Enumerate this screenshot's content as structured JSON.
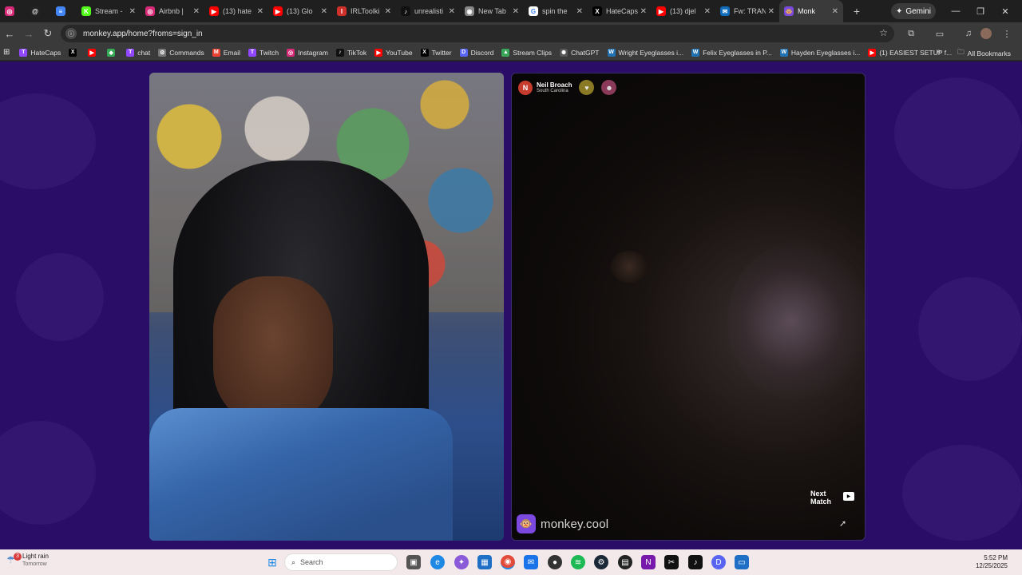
{
  "tabs": [
    {
      "label": "",
      "icon": "instagram-icon",
      "color": "#d62976",
      "glyph": "◎"
    },
    {
      "label": "",
      "icon": "threads-icon",
      "color": "#222222",
      "glyph": "@"
    },
    {
      "label": "",
      "icon": "docs-icon",
      "color": "#4285f4",
      "glyph": "≡"
    },
    {
      "label": "Stream -",
      "icon": "kick-icon",
      "color": "#53fc18",
      "glyph": "K"
    },
    {
      "label": "Airbnb |",
      "icon": "instagram-icon",
      "color": "#d62976",
      "glyph": "◎"
    },
    {
      "label": "(13) hate",
      "icon": "youtube-icon",
      "color": "#ff0000",
      "glyph": "▶"
    },
    {
      "label": "(13) Glo",
      "icon": "youtube-icon",
      "color": "#ff0000",
      "glyph": "▶"
    },
    {
      "label": "IRLToolki",
      "icon": "irltoolkit-icon",
      "color": "#d0302a",
      "glyph": "I"
    },
    {
      "label": "unrealisti",
      "icon": "tiktok-icon",
      "color": "#111111",
      "glyph": "♪"
    },
    {
      "label": "New Tab",
      "icon": "chrome-icon",
      "color": "#888888",
      "glyph": "◉"
    },
    {
      "label": "spin the",
      "icon": "google-icon",
      "color": "#ffffff",
      "glyph": "G"
    },
    {
      "label": "HateCaps",
      "icon": "x-icon",
      "color": "#000000",
      "glyph": "X"
    },
    {
      "label": "(13) djel",
      "icon": "youtube-icon",
      "color": "#ff0000",
      "glyph": "▶"
    },
    {
      "label": "Fw: TRAN",
      "icon": "outlook-icon",
      "color": "#0f6cbd",
      "glyph": "✉"
    },
    {
      "label": "Monk",
      "icon": "monkey-icon",
      "color": "#7b48e0",
      "glyph": "🐵",
      "active": true
    }
  ],
  "gemini_label": "Gemini",
  "address": "monkey.app/home?froms=sign_in",
  "bookmarks": [
    {
      "label": "HateCaps",
      "icon": "twitch-icon",
      "color": "#9146ff",
      "glyph": "T"
    },
    {
      "label": "",
      "icon": "x-icon",
      "color": "#000000",
      "glyph": "X"
    },
    {
      "label": "",
      "icon": "youtube-icon",
      "color": "#ff0000",
      "glyph": "▶"
    },
    {
      "label": "",
      "icon": "maps-icon",
      "color": "#34a853",
      "glyph": "◆"
    },
    {
      "label": "chat",
      "icon": "twitch-icon",
      "color": "#9146ff",
      "glyph": "T"
    },
    {
      "label": "Commands",
      "icon": "settings-icon",
      "color": "#777777",
      "glyph": "⚙"
    },
    {
      "label": "Email",
      "icon": "gmail-icon",
      "color": "#ea4335",
      "glyph": "M"
    },
    {
      "label": "Twitch",
      "icon": "twitch-icon",
      "color": "#9146ff",
      "glyph": "T"
    },
    {
      "label": "Instagram",
      "icon": "instagram-icon",
      "color": "#d62976",
      "glyph": "◎"
    },
    {
      "label": "TikTok",
      "icon": "tiktok-icon",
      "color": "#111111",
      "glyph": "♪"
    },
    {
      "label": "YouTube",
      "icon": "youtube-icon",
      "color": "#ff0000",
      "glyph": "▶"
    },
    {
      "label": "Twitter",
      "icon": "x-icon",
      "color": "#000000",
      "glyph": "X"
    },
    {
      "label": "Discord",
      "icon": "discord-icon",
      "color": "#5865f2",
      "glyph": "D"
    },
    {
      "label": "Stream Clips",
      "icon": "streamclips-icon",
      "color": "#3aa65a",
      "glyph": "▲"
    },
    {
      "label": "ChatGPT",
      "icon": "chatgpt-icon",
      "color": "#555555",
      "glyph": "✺"
    },
    {
      "label": "Wright Eyeglasses i...",
      "icon": "wordpress-icon",
      "color": "#2271b1",
      "glyph": "W"
    },
    {
      "label": "Felix Eyeglasses in P...",
      "icon": "wordpress-icon",
      "color": "#2271b1",
      "glyph": "W"
    },
    {
      "label": "Hayden Eyeglasses i...",
      "icon": "wordpress-icon",
      "color": "#2271b1",
      "glyph": "W"
    },
    {
      "label": "(1) EASIEST SETUP f...",
      "icon": "youtube-icon",
      "color": "#ff0000",
      "glyph": "▶"
    }
  ],
  "all_bookmarks": "All Bookmarks",
  "match": {
    "user_initial": "N",
    "user_name": "Neil Broach",
    "user_location": "South Carolina",
    "next_line1": "Next",
    "next_line2": "Match",
    "brand": "monkey.cool"
  },
  "taskbar": {
    "weather_title": "Light rain",
    "weather_sub": "Tomorrow",
    "weather_badge": "3",
    "search_placeholder": "Search",
    "time": "5:52 PM",
    "date": "12/25/2025"
  }
}
